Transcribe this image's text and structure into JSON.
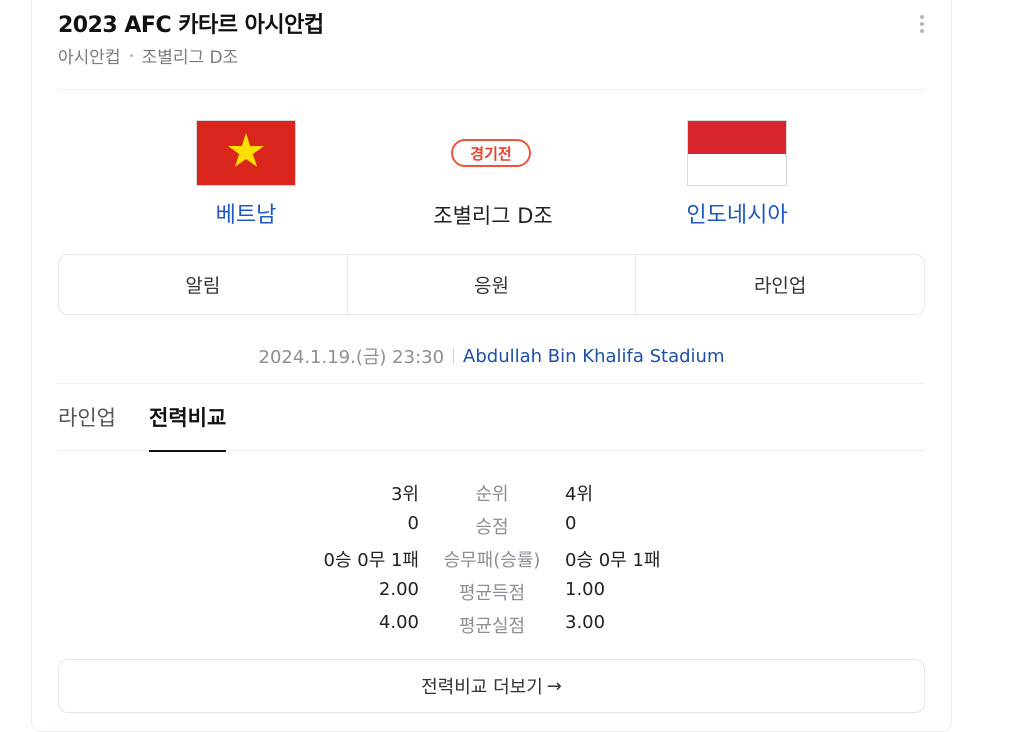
{
  "header": {
    "title": "2023 AFC 카타르 아시안컵",
    "breadcrumb": [
      "아시안컵",
      "조별리그 D조"
    ]
  },
  "match": {
    "status": "경기전",
    "round": "조별리그 D조",
    "home": {
      "name": "베트남",
      "flag": "vietnam-flag-icon"
    },
    "away": {
      "name": "인도네시아",
      "flag": "indonesia-flag-icon"
    },
    "datetime": "2024.1.19.(금) 23:30",
    "venue": "Abdullah Bin Khalifa Stadium"
  },
  "actions": [
    "알림",
    "응원",
    "라인업"
  ],
  "tabs": {
    "lineup": "라인업",
    "compare": "전력비교",
    "active": "compare"
  },
  "stats": [
    {
      "label": "순위",
      "home": "3위",
      "away": "4위"
    },
    {
      "label": "승점",
      "home": "0",
      "away": "0"
    },
    {
      "label": "승무패(승률)",
      "home": "0승 0무 1패",
      "away": "0승 0무 1패"
    },
    {
      "label": "평균득점",
      "home": "2.00",
      "away": "1.00"
    },
    {
      "label": "평균실점",
      "home": "4.00",
      "away": "3.00"
    }
  ],
  "more_compare": {
    "label": "전력비교 더보기",
    "arrow": "→"
  },
  "colors": {
    "link": "#1f57c3",
    "badge": "#e8412b",
    "muted": "#8a8f96"
  }
}
